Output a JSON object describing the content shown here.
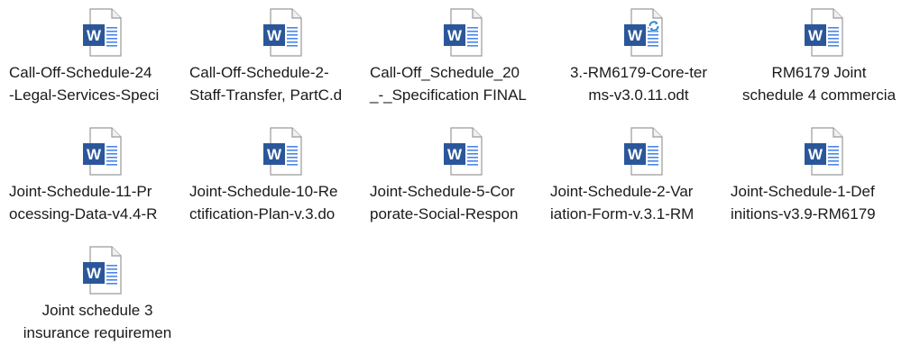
{
  "files": [
    {
      "line1": "Call-Off-Schedule-24",
      "line2": "-Legal-Services-Speci",
      "icon": "word-document-icon"
    },
    {
      "line1": "Call-Off-Schedule-2-",
      "line2": "Staff-Transfer, PartC.d",
      "icon": "word-document-icon"
    },
    {
      "line1": "Call-Off_Schedule_20",
      "line2": "_-_Specification FINAL",
      "icon": "word-document-icon"
    },
    {
      "line1": "3.-RM6179-Core-ter",
      "line2": "ms-v3.0.11.odt",
      "icon": "word-odt-document-icon"
    },
    {
      "line1": "RM6179 Joint",
      "line2": "schedule 4 commercia",
      "icon": "word-document-icon"
    },
    {
      "line1": "Joint-Schedule-11-Pr",
      "line2": "ocessing-Data-v4.4-R",
      "icon": "word-document-icon"
    },
    {
      "line1": "Joint-Schedule-10-Re",
      "line2": "ctification-Plan-v.3.do",
      "icon": "word-document-icon"
    },
    {
      "line1": "Joint-Schedule-5-Cor",
      "line2": "porate-Social-Respon",
      "icon": "word-document-icon"
    },
    {
      "line1": "Joint-Schedule-2-Var",
      "line2": "iation-Form-v.3.1-RM",
      "icon": "word-document-icon"
    },
    {
      "line1": "Joint-Schedule-1-Def",
      "line2": "initions-v3.9-RM6179",
      "icon": "word-document-icon"
    },
    {
      "line1": "Joint schedule 3",
      "line2": "insurance requiremen",
      "icon": "word-document-icon"
    }
  ],
  "icon_text": {
    "w": "W"
  },
  "colors": {
    "word_blue": "#2b579a",
    "word_blue_light": "#4a86e8",
    "page_border": "#9a9a9a",
    "sync_blue": "#2e8bd8"
  }
}
